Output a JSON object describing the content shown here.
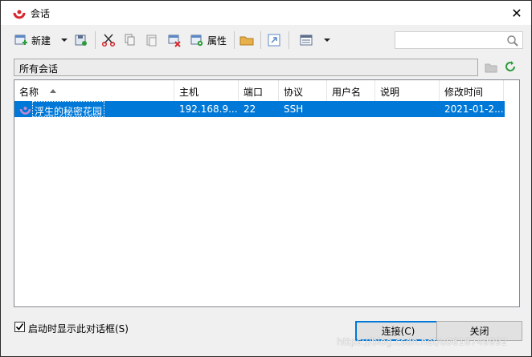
{
  "window": {
    "title": "会话",
    "close_glyph": "✕"
  },
  "toolbar": {
    "new_label": "新建",
    "properties_label": "属性",
    "search_placeholder": ""
  },
  "folder": {
    "path": "所有会话"
  },
  "list": {
    "columns": [
      "名称",
      "主机",
      "端口",
      "协议",
      "用户名",
      "说明",
      "修改时间"
    ],
    "rows": [
      {
        "name": "浮生的秘密花园",
        "host": "192.168.9...",
        "port": "22",
        "protocol": "SSH",
        "user": "",
        "description": "",
        "modified": "2021-01-2..."
      }
    ]
  },
  "footer": {
    "startup_checkbox_label": "启动时显示此对话框(S)",
    "startup_checked": true,
    "connect_label": "连接(C)",
    "close_label": "关闭"
  },
  "watermark": "https://blog.csdn.net/u0616749992",
  "colors": {
    "selection": "#0078d7",
    "accent_red": "#d9262e",
    "accent_green": "#2e9c3c"
  }
}
